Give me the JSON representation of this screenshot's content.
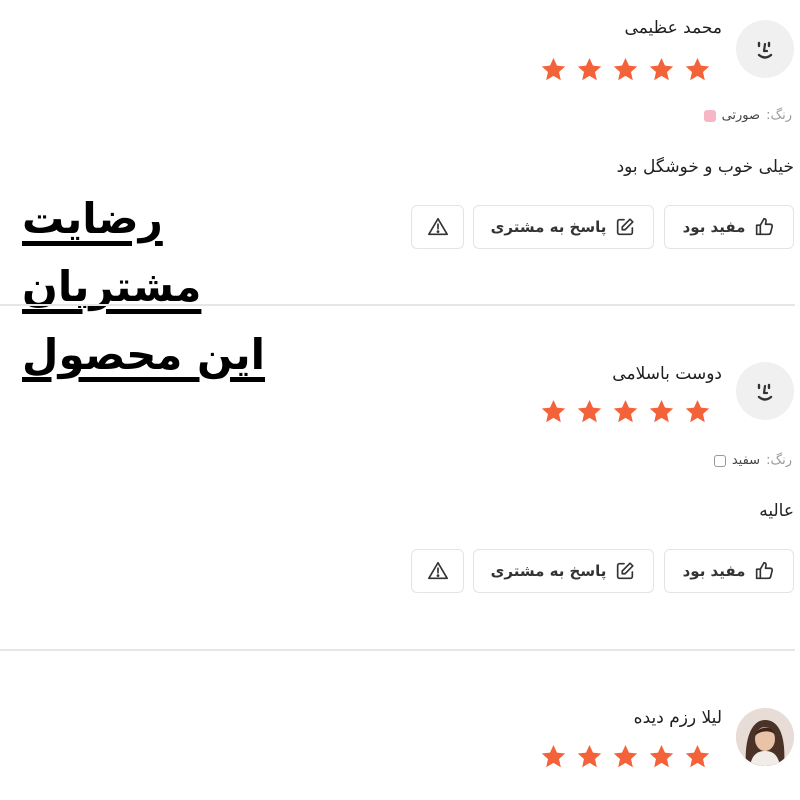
{
  "headline": {
    "lines": [
      "رضایت",
      "مشتریان",
      "این محصول"
    ]
  },
  "reviews": [
    {
      "name": "محمد عظیمی",
      "rating": 5,
      "color_label": "رنگ:",
      "color_value": "صورتی",
      "color_hex": "#f7b6c3",
      "comment": "خیلی خوب و خوشگل بود",
      "helpful_label": "مفید بود",
      "reply_label": "پاسخ به مشتری"
    },
    {
      "name": "دوست باسلامی",
      "rating": 5,
      "color_label": "رنگ:",
      "color_value": "سفید",
      "color_hex": "#ffffff",
      "comment": "عالیه",
      "helpful_label": "مفید بود",
      "reply_label": "پاسخ به مشتری"
    },
    {
      "name": "لیلا رزم دیده",
      "rating": 5
    }
  ],
  "colors": {
    "star": "#f4623a",
    "border": "#e4e4e6"
  },
  "icons": {
    "avatar": "smiley-face-icon",
    "helpful": "thumbs-up-icon",
    "reply": "pencil-edit-icon",
    "report": "warning-triangle-icon"
  }
}
